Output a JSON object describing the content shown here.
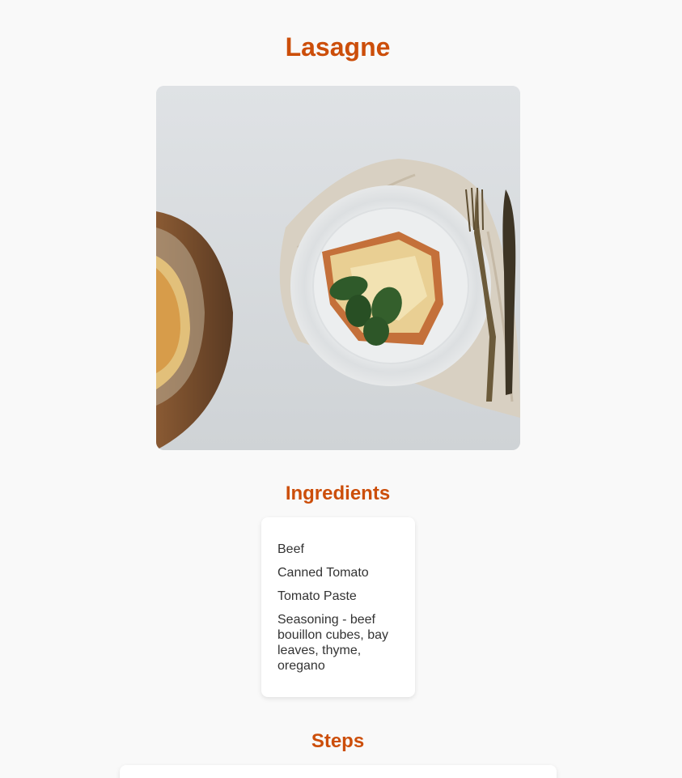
{
  "recipe": {
    "title": "Lasagne"
  },
  "image": {
    "subject": "lasagne-photo"
  },
  "ingredients": {
    "heading": "Ingredients",
    "items": [
      "Beef",
      "Canned Tomato",
      "Tomato Paste",
      "Seasoning - beef bouillon cubes, bay leaves, thyme, oregano"
    ]
  },
  "steps": {
    "heading": "Steps"
  },
  "colors": {
    "accent": "#cc4e0a",
    "background": "#f9f9f9",
    "card": "#ffffff",
    "text": "#333333"
  }
}
